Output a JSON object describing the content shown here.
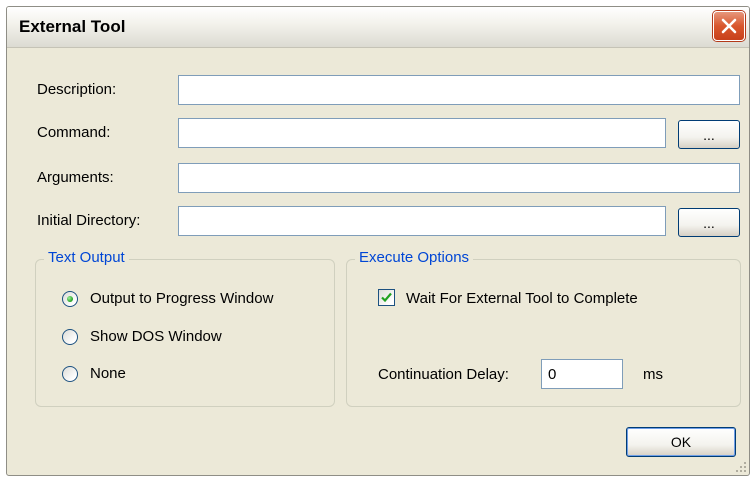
{
  "window": {
    "title": "External Tool"
  },
  "form": {
    "description_label": "Description:",
    "description_value": "",
    "command_label": "Command:",
    "command_value": "",
    "command_browse_label": "...",
    "arguments_label": "Arguments:",
    "arguments_value": "",
    "initial_directory_label": "Initial Directory:",
    "initial_directory_value": "",
    "initial_directory_browse_label": "..."
  },
  "text_output": {
    "legend": "Text Output",
    "options": [
      {
        "label": "Output to Progress Window",
        "selected": true
      },
      {
        "label": "Show DOS Window",
        "selected": false
      },
      {
        "label": "None",
        "selected": false
      }
    ]
  },
  "execute_options": {
    "legend": "Execute Options",
    "wait_label": "Wait For External Tool to Complete",
    "wait_checked": true,
    "delay_label": "Continuation Delay:",
    "delay_value": "0",
    "delay_unit": "ms"
  },
  "buttons": {
    "ok_label": "OK"
  },
  "colors": {
    "dialog_bg": "#ece9d8",
    "group_legend": "#0046d5",
    "close_button": "#d9572d",
    "field_border": "#7f9db9"
  }
}
